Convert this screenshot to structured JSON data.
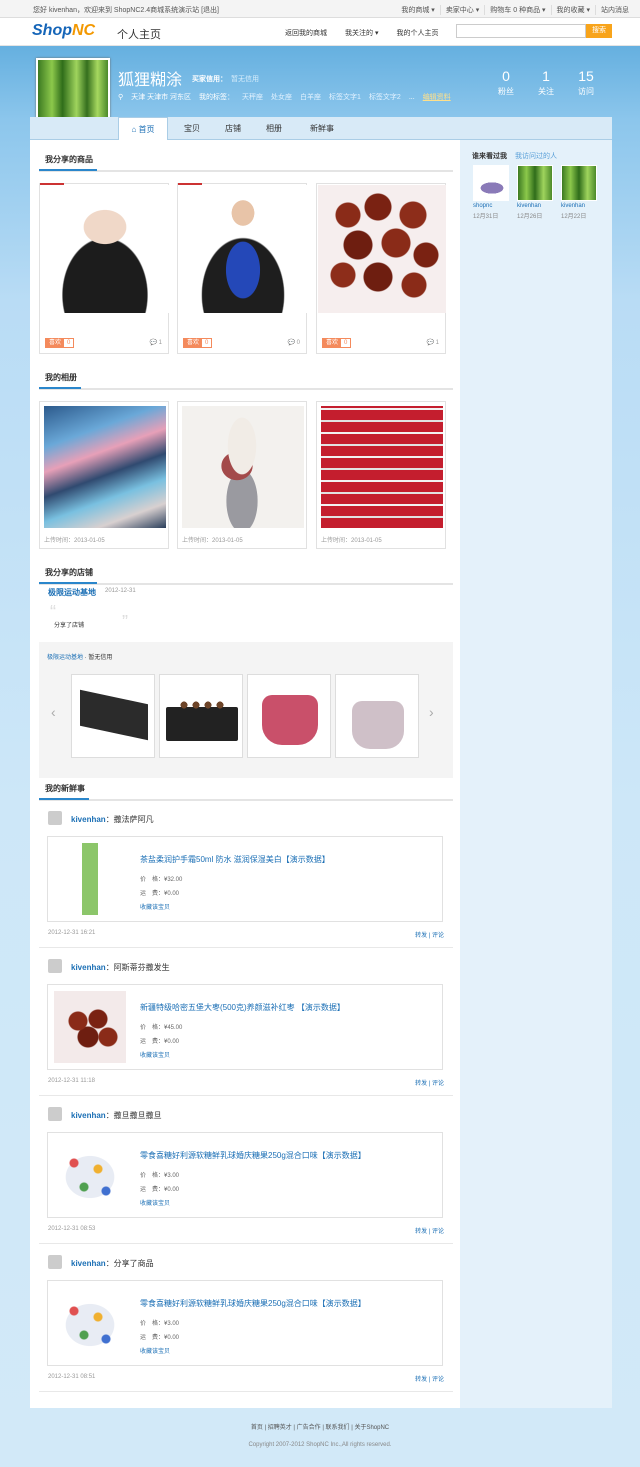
{
  "topbar": {
    "welcome": "您好 kivenhan，欢迎来到 ShopNC2.4商城系统演示站",
    "logout": "[退出]",
    "links": [
      "我的商城 ▾",
      "卖家中心 ▾",
      "购物车 0 种商品 ▾",
      "我的收藏 ▾",
      "站内消息"
    ]
  },
  "header": {
    "logo": "ShopNC",
    "subtitle": "个人主页",
    "nav": [
      "返回我的商城",
      "我关注的 ▾",
      "我的个人主页"
    ],
    "search_btn": "搜索"
  },
  "profile": {
    "name": "狐狸糊涂",
    "credit_label": "买家信用：",
    "credit_value": "暂无信用",
    "location": "天津 天津市 河东区",
    "tags_label": "我的标签：",
    "tags": [
      "天秤座",
      "处女座",
      "白羊座",
      "标签文字1",
      "标签文字2"
    ],
    "more": "...",
    "edit": "编辑资料",
    "stats": [
      {
        "num": "0",
        "label": "粉丝"
      },
      {
        "num": "1",
        "label": "关注"
      },
      {
        "num": "15",
        "label": "访问"
      }
    ]
  },
  "tabs": [
    "首页",
    "宝贝",
    "店铺",
    "相册",
    "新鲜事"
  ],
  "sections": {
    "goods": "我分享的商品",
    "albums": "我的相册",
    "stores": "我分享的店铺",
    "news": "我的新鲜事"
  },
  "goods": [
    {
      "like": "喜欢",
      "like_count": "0",
      "comments": "1"
    },
    {
      "like": "喜欢",
      "like_count": "0",
      "comments": "0"
    },
    {
      "like": "喜欢",
      "like_count": "0",
      "comments": "1"
    }
  ],
  "albums": [
    {
      "date": "上传时间：2013-01-05"
    },
    {
      "date": "上传时间：2013-01-05"
    },
    {
      "date": "上传时间：2013-01-05"
    }
  ],
  "store": {
    "name": "极限运动基地",
    "date": "2012-12-31",
    "text": "分享了店铺",
    "box_name": "极限运动基地",
    "box_credit": " · 暂无信用"
  },
  "feeds": [
    {
      "user": "kivenhan",
      "action": "：撒法萨阿凡",
      "title": "茶盐柔润护手霜50ml 防水 滋润保湿美白【演示数据】",
      "price": "价　格：¥32.00",
      "ship": "运　费：¥0.00",
      "fav": "收藏该宝贝",
      "date": "2012-12-31 16:21",
      "ops": "转发 | 评论"
    },
    {
      "user": "kivenhan",
      "action": "：阿斯蒂芬撒发生",
      "title": "新疆特级哈密五堡大枣(500克)养颜滋补红枣 【演示数据】",
      "price": "价　格：¥45.00",
      "ship": "运　费：¥0.00",
      "fav": "收藏该宝贝",
      "date": "2012-12-31 11:18",
      "ops": "转发 | 评论"
    },
    {
      "user": "kivenhan",
      "action": "：撒旦撒旦撒旦",
      "title": "零食喜糖好利源软糖鲜乳球婚庆糖果250g混合口味【演示数据】",
      "price": "价　格：¥3.00",
      "ship": "运　费：¥0.00",
      "fav": "收藏该宝贝",
      "date": "2012-12-31 08:53",
      "ops": "转发 | 评论"
    },
    {
      "user": "kivenhan",
      "action": "：分享了商品",
      "title": "零食喜糖好利源软糖鲜乳球婚庆糖果250g混合口味【演示数据】",
      "price": "价　格：¥3.00",
      "ship": "运　费：¥0.00",
      "fav": "收藏该宝贝",
      "date": "2012-12-31 08:51",
      "ops": "转发 | 评论"
    }
  ],
  "side": {
    "title": "谁来看过我",
    "alt": "我访问过的人",
    "visitors": [
      {
        "name": "shopnc",
        "date": "12月31日"
      },
      {
        "name": "kivenhan",
        "date": "12月26日"
      },
      {
        "name": "kivenhan",
        "date": "12月22日"
      }
    ]
  },
  "footer": {
    "links": "首页 | 招聘英才 | 广告合作 | 联系我们 | 关于ShopNC",
    "copyright": "Copyright 2007-2012 ShopNC Inc.,All rights reserved."
  }
}
